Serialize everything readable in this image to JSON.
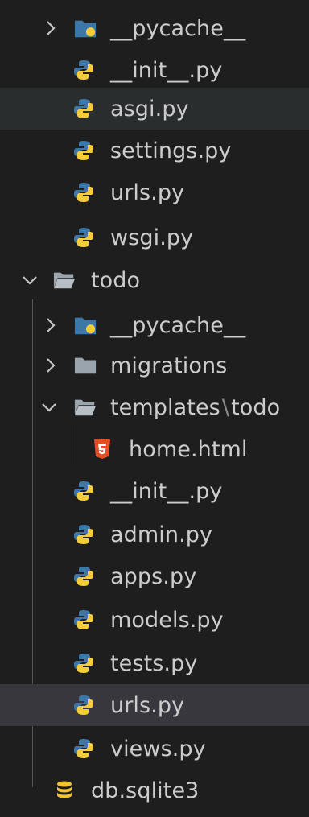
{
  "tree": {
    "rows": [
      {
        "label": "__pycache__",
        "icon": "python-folder-icon",
        "chevron": "chevron-right-icon",
        "selected": false
      },
      {
        "label": "__init__.py",
        "icon": "python-file-icon"
      },
      {
        "label": "asgi.py",
        "icon": "python-file-icon",
        "hover": true
      },
      {
        "label": "settings.py",
        "icon": "python-file-icon"
      },
      {
        "label": "urls.py",
        "icon": "python-file-icon"
      },
      {
        "label": "wsgi.py",
        "icon": "python-file-icon"
      },
      {
        "label": "todo",
        "icon": "folder-open-icon",
        "chevron": "chevron-down-icon"
      },
      {
        "label": "__pycache__",
        "icon": "python-folder-icon",
        "chevron": "chevron-right-icon"
      },
      {
        "label": "migrations",
        "icon": "folder-icon",
        "chevron": "chevron-right-icon"
      },
      {
        "label_parts": [
          "templates",
          "\\",
          "todo"
        ],
        "icon": "folder-open-icon",
        "chevron": "chevron-down-icon"
      },
      {
        "label": "home.html",
        "icon": "html5-icon"
      },
      {
        "label": "__init__.py",
        "icon": "python-file-icon"
      },
      {
        "label": "admin.py",
        "icon": "python-file-icon"
      },
      {
        "label": "apps.py",
        "icon": "python-file-icon"
      },
      {
        "label": "models.py",
        "icon": "python-file-icon"
      },
      {
        "label": "tests.py",
        "icon": "python-file-icon"
      },
      {
        "label": "urls.py",
        "icon": "python-file-icon",
        "selected": true
      },
      {
        "label": "views.py",
        "icon": "python-file-icon"
      },
      {
        "label": "db.sqlite3",
        "icon": "database-icon"
      }
    ]
  },
  "colors": {
    "background": "#1e1e1e",
    "text": "#cccccc",
    "hover": "#2a2d2e",
    "selected": "#37373d",
    "python_blue": "#3b77a8",
    "python_yellow": "#f5cc3c",
    "folder_gray": "#9aa4ad",
    "html_orange": "#e44d26",
    "db_yellow": "#f3c431"
  }
}
